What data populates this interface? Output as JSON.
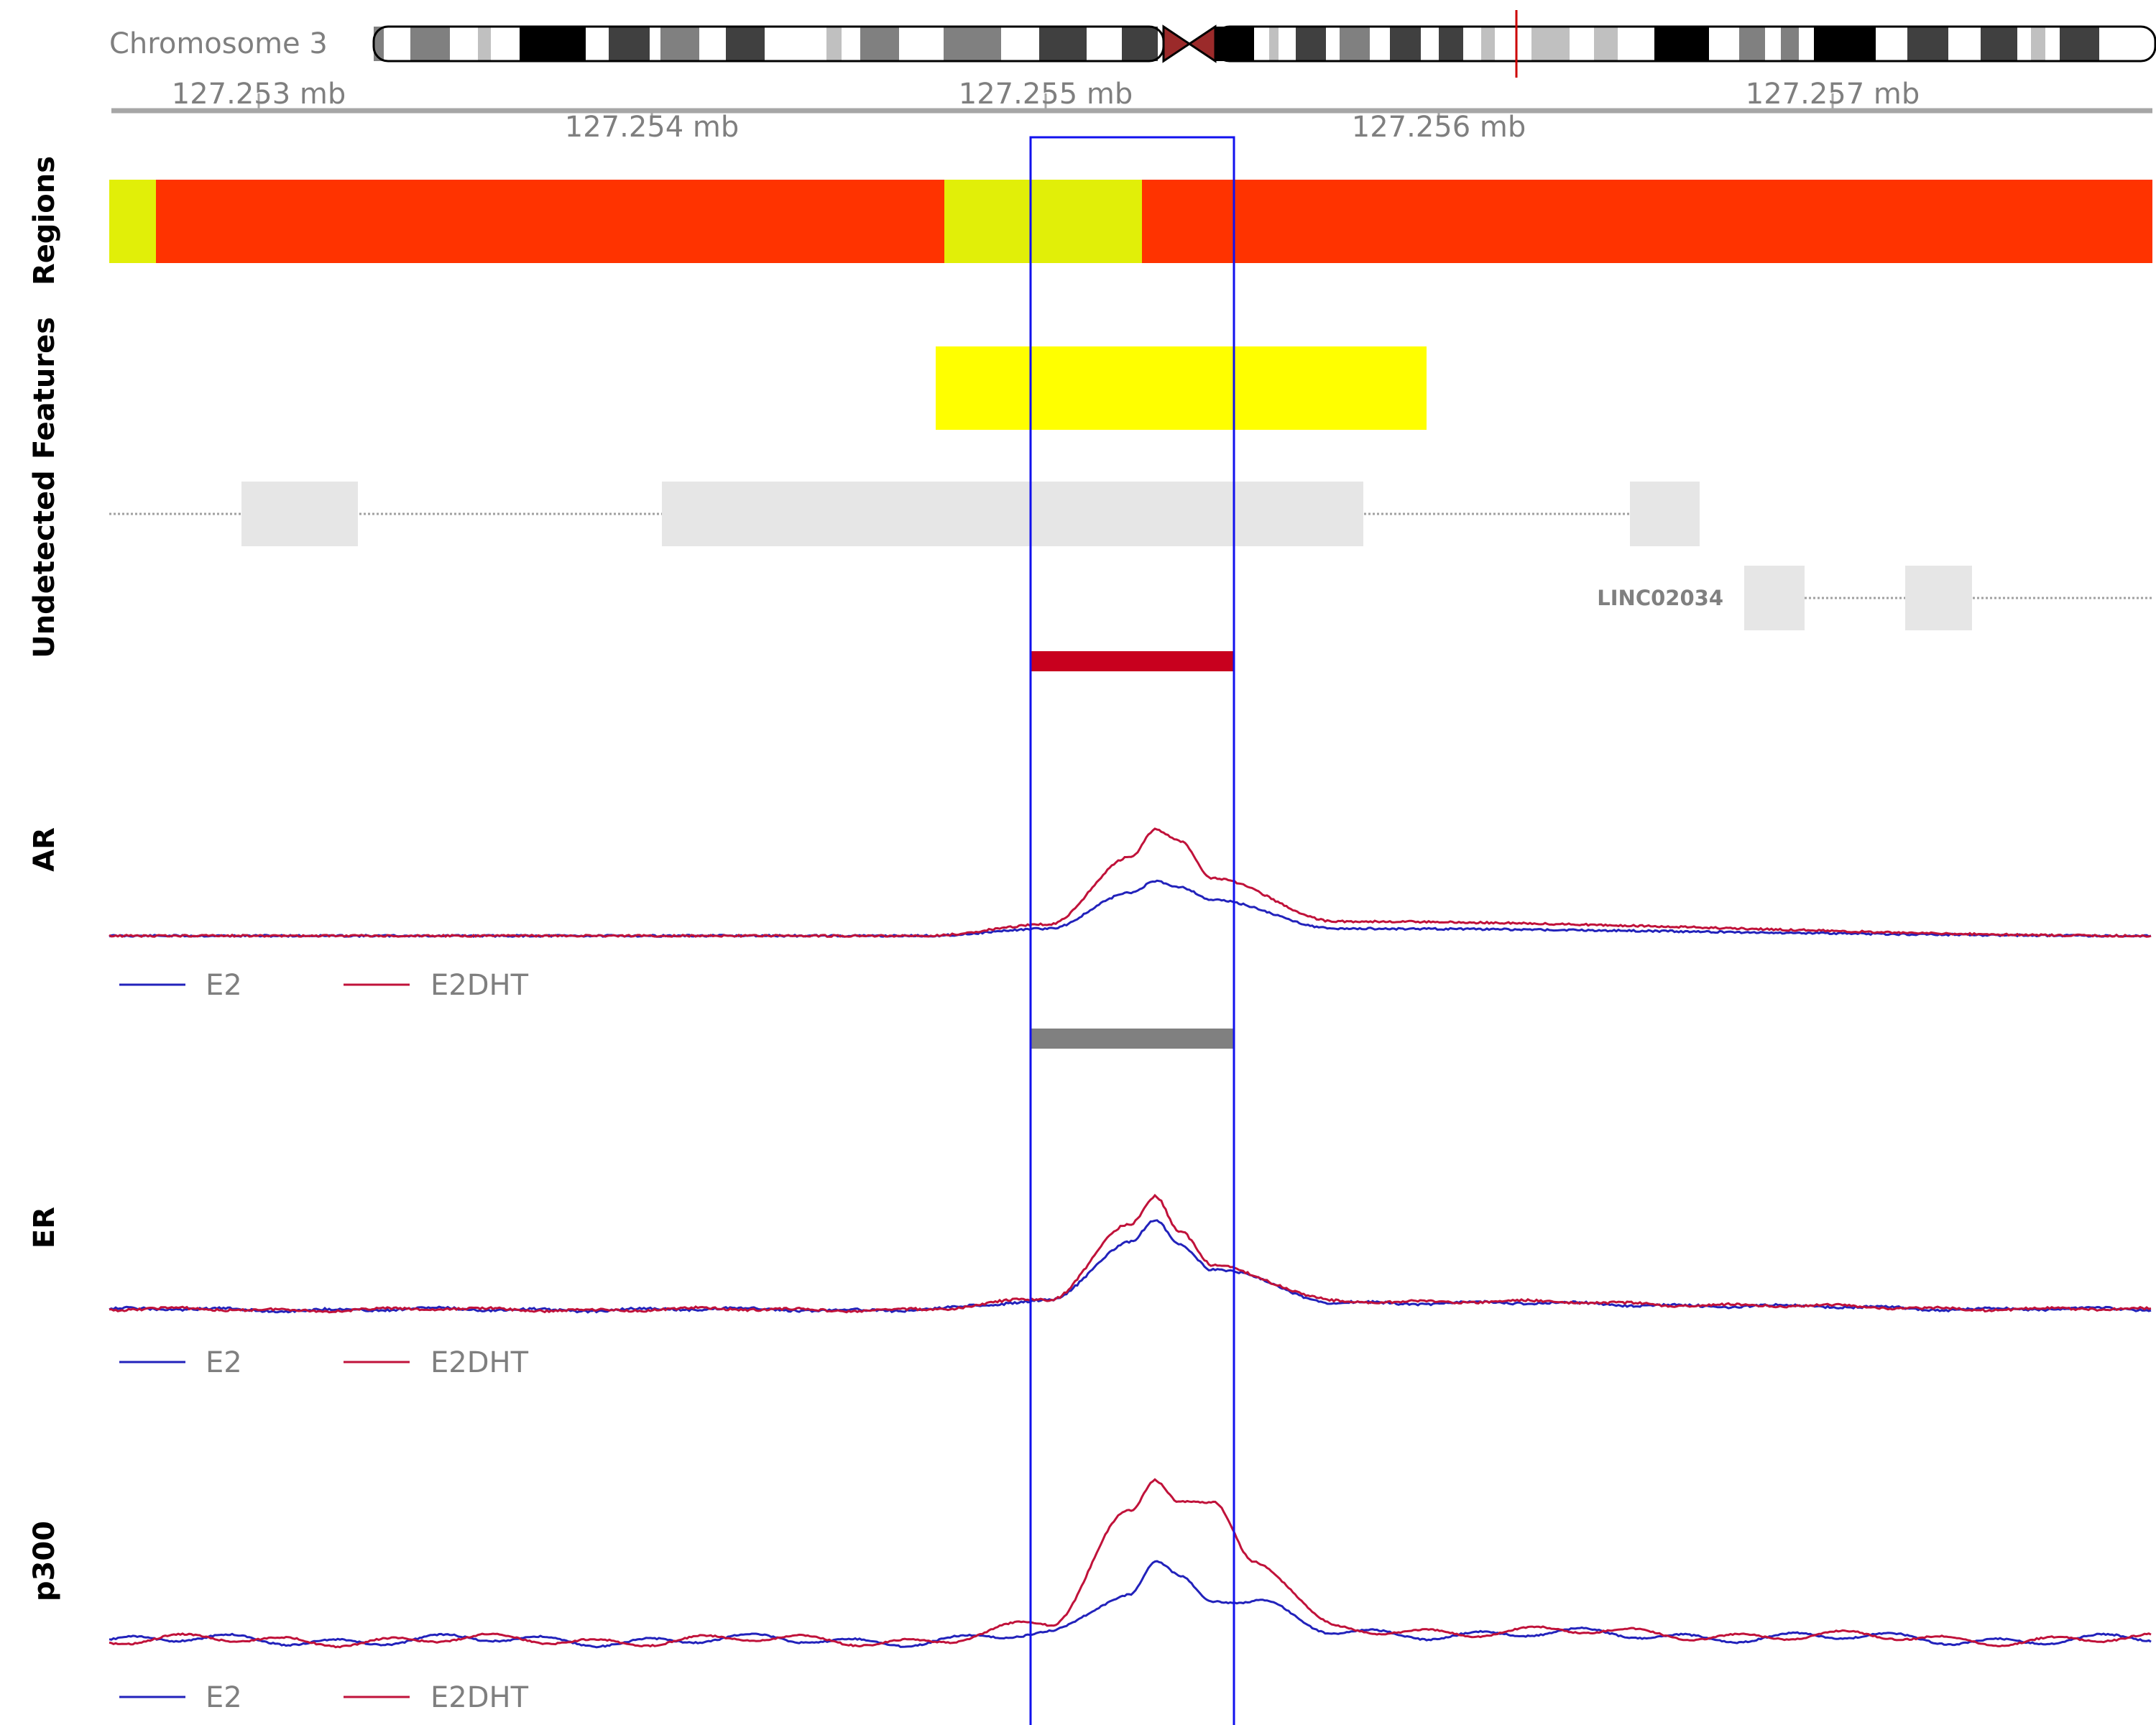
{
  "chromosome": {
    "label": "Chromosome 3",
    "highlight_color": "#cc0000"
  },
  "axis": {
    "ticks_upper": [
      "127.253 mb",
      "127.255 mb",
      "127.257 mb"
    ],
    "ticks_lower": [
      "127.254 mb",
      "127.256 mb"
    ]
  },
  "tracks": {
    "regions": "Regions",
    "features": "Features",
    "undetected": "Undetected",
    "ar": "AR",
    "er": "ER",
    "p300": "p300"
  },
  "genes": {
    "lincRNA": "LINC02034"
  },
  "legend": {
    "e2": "E2",
    "e2dht": "E2DHT"
  },
  "colors": {
    "region_yellow": "#e1ef08",
    "region_red": "#ff3300",
    "feature_yellow": "#ffff00",
    "peak_red": "#c8001e",
    "peak_grey": "#808080",
    "exon_grey": "#e6e6e6",
    "series_e2": "#2222bb",
    "series_e2dht": "#c0123a",
    "highlight_box": "#1111ee"
  },
  "chart_data": [
    {
      "type": "line",
      "title": "AR",
      "x": [
        127.2525,
        127.2545,
        127.2548,
        127.255,
        127.25506,
        127.25512,
        127.2552,
        127.2555,
        127.2575
      ],
      "series": [
        {
          "name": "E2",
          "values": [
            0,
            0,
            0.05,
            0.3,
            0.38,
            0.34,
            0.25,
            0.05,
            0
          ]
        },
        {
          "name": "E2DHT",
          "values": [
            0,
            0,
            0.08,
            0.55,
            0.74,
            0.66,
            0.4,
            0.1,
            0
          ]
        }
      ]
    },
    {
      "type": "line",
      "title": "ER",
      "x": [
        127.2525,
        127.2545,
        127.2548,
        127.255,
        127.25506,
        127.25512,
        127.2552,
        127.2555,
        127.2575
      ],
      "series": [
        {
          "name": "E2",
          "values": [
            0,
            0,
            0.06,
            0.48,
            0.62,
            0.45,
            0.28,
            0.05,
            0
          ]
        },
        {
          "name": "E2DHT",
          "values": [
            0,
            0,
            0.07,
            0.6,
            0.8,
            0.55,
            0.3,
            0.06,
            0
          ]
        }
      ]
    },
    {
      "type": "line",
      "title": "p300",
      "x": [
        127.2525,
        127.2545,
        127.2548,
        127.255,
        127.25506,
        127.25512,
        127.2552,
        127.2553,
        127.2555,
        127.2575
      ],
      "series": [
        {
          "name": "E2",
          "values": [
            0.05,
            0.05,
            0.08,
            0.4,
            0.6,
            0.5,
            0.35,
            0.3,
            0.1,
            0.05
          ]
        },
        {
          "name": "E2DHT",
          "values": [
            0.05,
            0.05,
            0.15,
            0.95,
            1.2,
            1.05,
            1.0,
            0.6,
            0.12,
            0.05
          ]
        }
      ]
    }
  ]
}
